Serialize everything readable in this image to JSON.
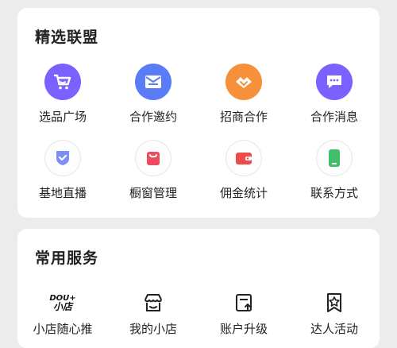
{
  "alliance": {
    "title": "精选联盟",
    "items": [
      {
        "label": "选品广场",
        "icon": "shopping-cart-icon",
        "color": "#7b61ff"
      },
      {
        "label": "合作邀约",
        "icon": "envelope-icon",
        "color": "#5b7cf7"
      },
      {
        "label": "招商合作",
        "icon": "handshake-icon",
        "color": "#f7903b"
      },
      {
        "label": "合作消息",
        "icon": "chat-bubble-icon",
        "color": "#7b61ff"
      },
      {
        "label": "基地直播",
        "icon": "shield-check-icon",
        "color": "#5b7cf7"
      },
      {
        "label": "橱窗管理",
        "icon": "shopping-bag-icon",
        "color": "#ef4b5f"
      },
      {
        "label": "佣金统计",
        "icon": "wallet-icon",
        "color": "#ef4b4b"
      },
      {
        "label": "联系方式",
        "icon": "phone-icon",
        "color": "#3fbf6a"
      }
    ]
  },
  "services": {
    "title": "常用服务",
    "logo_text_top": "DOU+",
    "logo_text_bottom": "小店",
    "items": [
      {
        "label": "小店随心推",
        "icon": "dou-plus-logo"
      },
      {
        "label": "我的小店",
        "icon": "store-icon"
      },
      {
        "label": "账户升级",
        "icon": "upgrade-icon"
      },
      {
        "label": "达人活动",
        "icon": "star-flag-icon"
      }
    ]
  }
}
